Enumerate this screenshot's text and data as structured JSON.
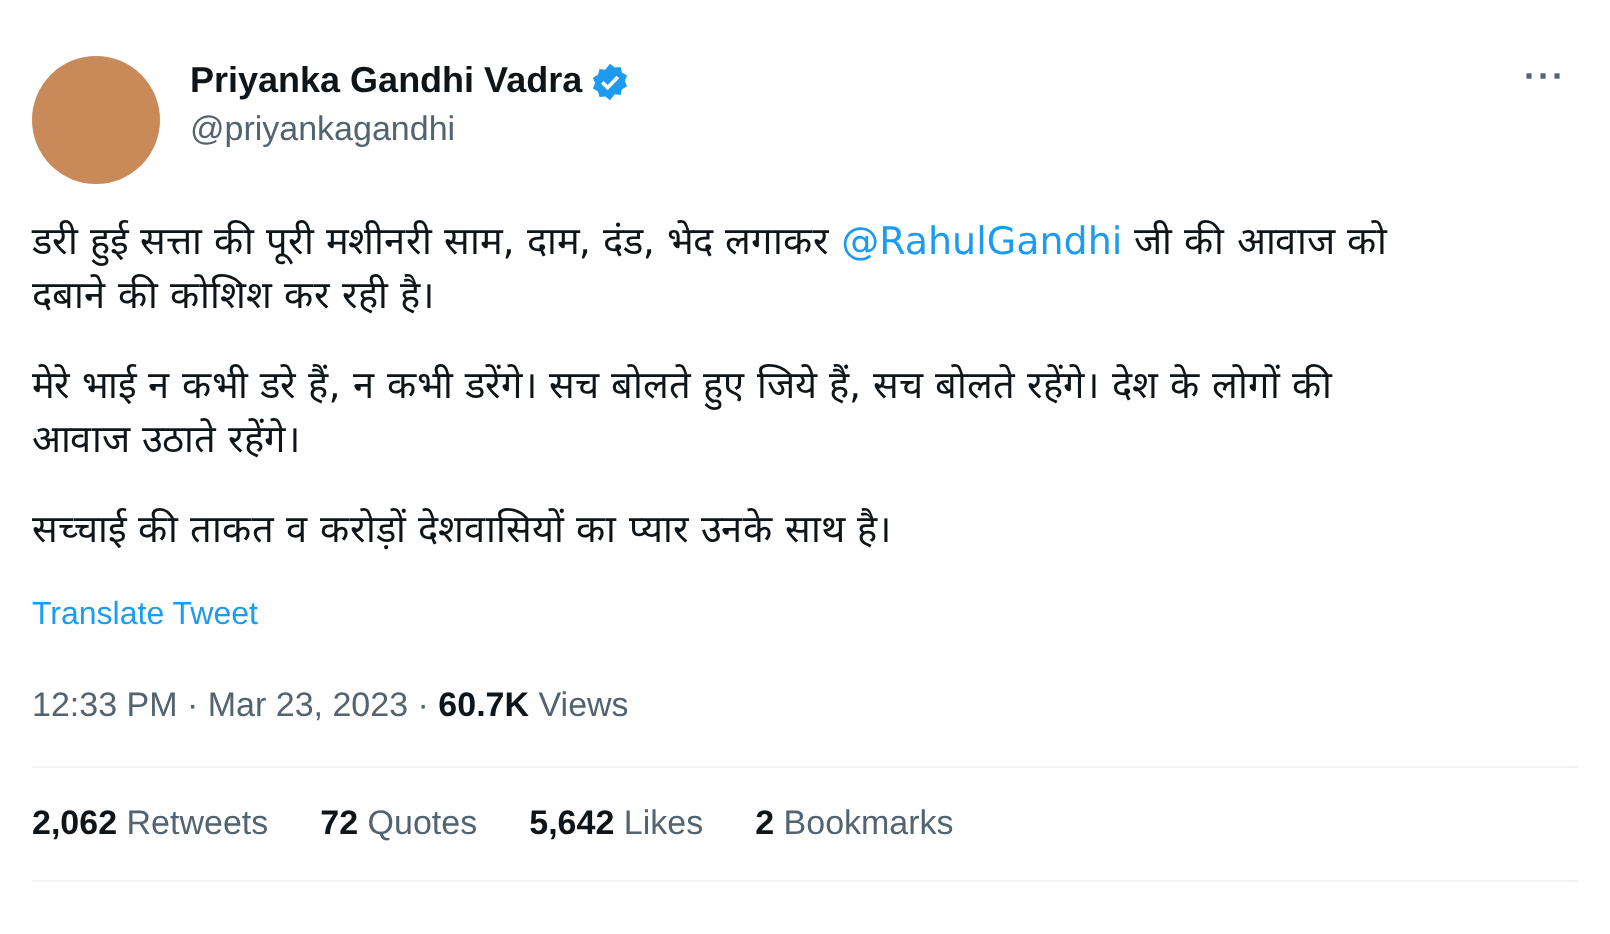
{
  "author": {
    "name": "Priyanka Gandhi Vadra",
    "verified": true,
    "handle": "@priyankagandhi"
  },
  "more": "···",
  "paragraphs": [
    {
      "parts": [
        {
          "kind": "plain",
          "text": "डरी हुई सत्ता की पूरी मशीनरी साम, दाम, दंड, भेद लगाकर "
        },
        {
          "kind": "mention",
          "text": "@RahulGandhi"
        },
        {
          "kind": "plain",
          "text": " जी की आवाज को दबाने की कोशिश कर रही है।"
        }
      ]
    },
    {
      "parts": [
        {
          "kind": "plain",
          "text": "मेरे भाई न कभी डरे हैं, न कभी डरेंगे। सच बोलते हुए जिये हैं, सच बोलते रहेंगे। देश के लोगों की आवाज उठाते रहेंगे।"
        }
      ]
    },
    {
      "parts": [
        {
          "kind": "plain",
          "text": "सच्चाई की ताकत व करोड़ों देशवासियों का प्यार उनके साथ है।"
        }
      ]
    }
  ],
  "translate": "Translate Tweet",
  "meta": "12:33 PM · Mar 23, 2023 · **60.7K** Views",
  "stats": [
    {
      "text": "**2,062** Retweets"
    },
    {
      "text": "**72** Quotes"
    },
    {
      "text": "**5,642** Likes"
    },
    {
      "text": "**2** Bookmarks"
    }
  ]
}
